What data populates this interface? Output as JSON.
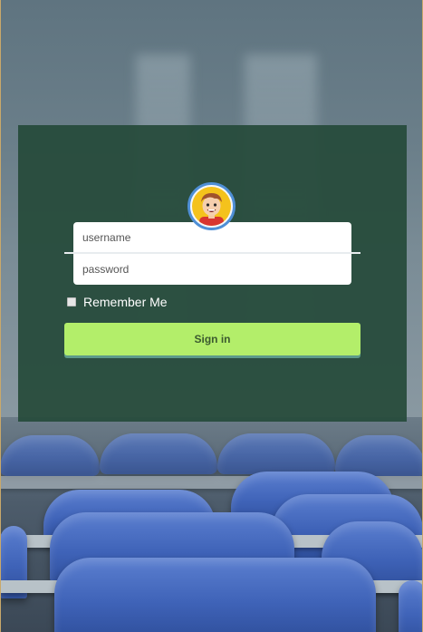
{
  "login": {
    "username_placeholder": "username",
    "password_placeholder": "password",
    "remember_label": "Remember Me",
    "signin_label": "Sign in",
    "avatar_icon": "cartoon-boy-avatar-icon"
  },
  "colors": {
    "panel": "#264a3a",
    "button": "#b3ee6a",
    "avatar_ring": "#4f8fd6",
    "avatar_bg": "#f4c21c",
    "seats": "#3f63b8"
  }
}
